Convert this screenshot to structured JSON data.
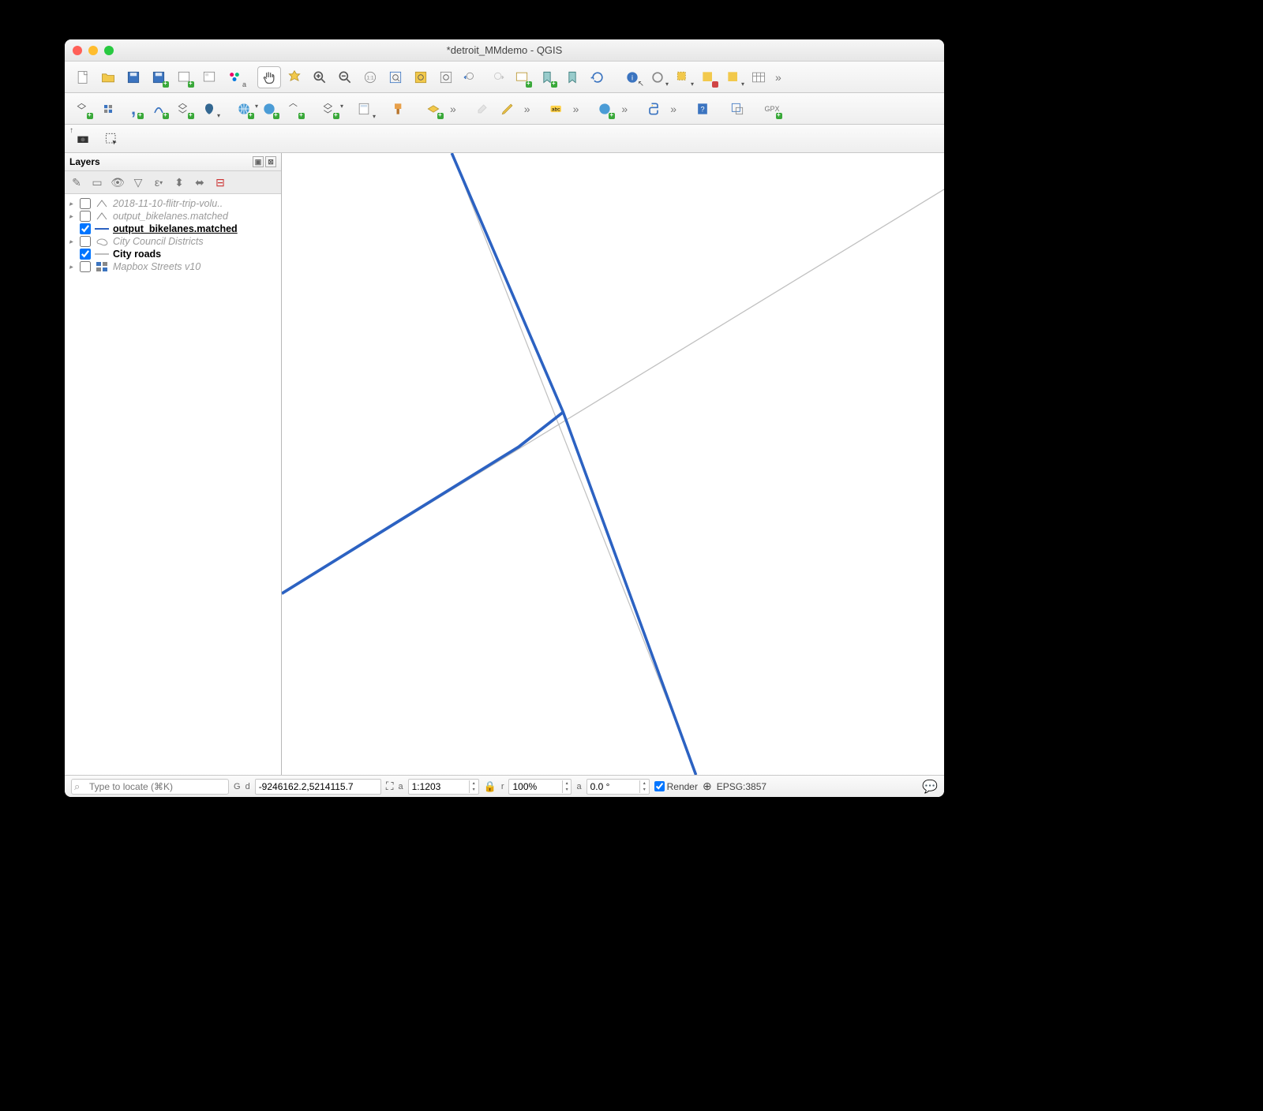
{
  "window": {
    "title": "*detroit_MMdemo - QGIS"
  },
  "layers_panel": {
    "title": "Layers",
    "items": [
      {
        "name": "2018-11-10-flitr-trip-volu..",
        "checked": false,
        "dim": true,
        "expandable": true,
        "color": "#555",
        "icon": "vector"
      },
      {
        "name": "output_bikelanes.matched",
        "checked": false,
        "dim": true,
        "expandable": true,
        "color": "#555",
        "icon": "vector"
      },
      {
        "name": "output_bikelanes.matched",
        "checked": true,
        "selected": true,
        "expandable": false,
        "color": "#2c62c2",
        "icon": "line"
      },
      {
        "name": "City Council Districts",
        "checked": false,
        "dim": true,
        "expandable": true,
        "color": "#999",
        "icon": "poly"
      },
      {
        "name": "City roads",
        "checked": true,
        "bold": true,
        "expandable": false,
        "color": "#bfbfbf",
        "icon": "line"
      },
      {
        "name": "Mapbox Streets v10",
        "checked": false,
        "dim": true,
        "expandable": true,
        "color": "#666",
        "icon": "tiles"
      }
    ]
  },
  "status": {
    "search_placeholder": "Type to locate (⌘K)",
    "coord_prefix": "d",
    "coord": "-9246162.2,5214115.7",
    "scale_label": "a",
    "scale": "1:1203",
    "mag_label": "r",
    "mag": "100%",
    "rot_label": "a",
    "rot": "0.0 °",
    "render_label": "Render",
    "crs": "EPSG:3857"
  }
}
